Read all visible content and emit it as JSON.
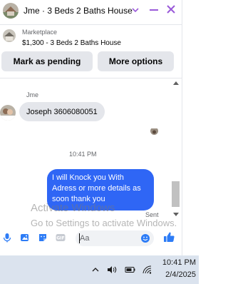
{
  "header": {
    "title": "Jme · 3 Beds 2 Baths House"
  },
  "listing": {
    "source_label": "Marketplace",
    "title": "$1,300 - 3 Beds 2 Baths House",
    "mark_pending_label": "Mark as pending",
    "more_options_label": "More options"
  },
  "conversation": {
    "sender_name": "Jme",
    "incoming_message": "Joseph 3606080051",
    "timestamp": "10:41 PM",
    "outgoing_message": "I will Knock you With Adress or more details  as soon thank you",
    "status": "Sent"
  },
  "watermark": {
    "line1": "Activate Windows",
    "line2": "Go to Settings to activate Windows."
  },
  "composer": {
    "placeholder": "Aa"
  },
  "taskbar": {
    "time": "10:41 PM",
    "date": "2/4/2025"
  },
  "colors": {
    "accent": "#9a5ad9",
    "outgoing_bubble": "#2f66f5",
    "composer_icons": "#2d7cf6",
    "button_bg": "#e4e6eb"
  }
}
